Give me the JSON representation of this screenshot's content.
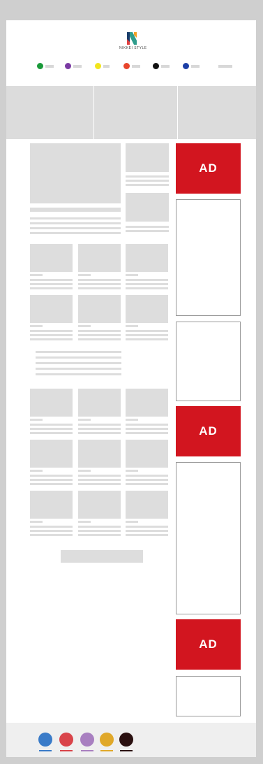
{
  "brand": {
    "logo_text": "NIKKEI STYLE",
    "colors": {
      "accent": "#d2151f",
      "grey": "#dddddd"
    }
  },
  "nav": {
    "dot_colors": [
      "#1a9a3a",
      "#7a3aa3",
      "#f2e51c",
      "#e8452c",
      "#111111",
      "#1c3fa6"
    ]
  },
  "sidebar": {
    "ads": [
      {
        "label": "AD"
      },
      {
        "label": "AD"
      },
      {
        "label": "AD"
      }
    ]
  },
  "footer": {
    "dot_colors": [
      "#3a7bc8",
      "#d9444a",
      "#a87fc0",
      "#e0a82a",
      "#2a1010"
    ]
  }
}
